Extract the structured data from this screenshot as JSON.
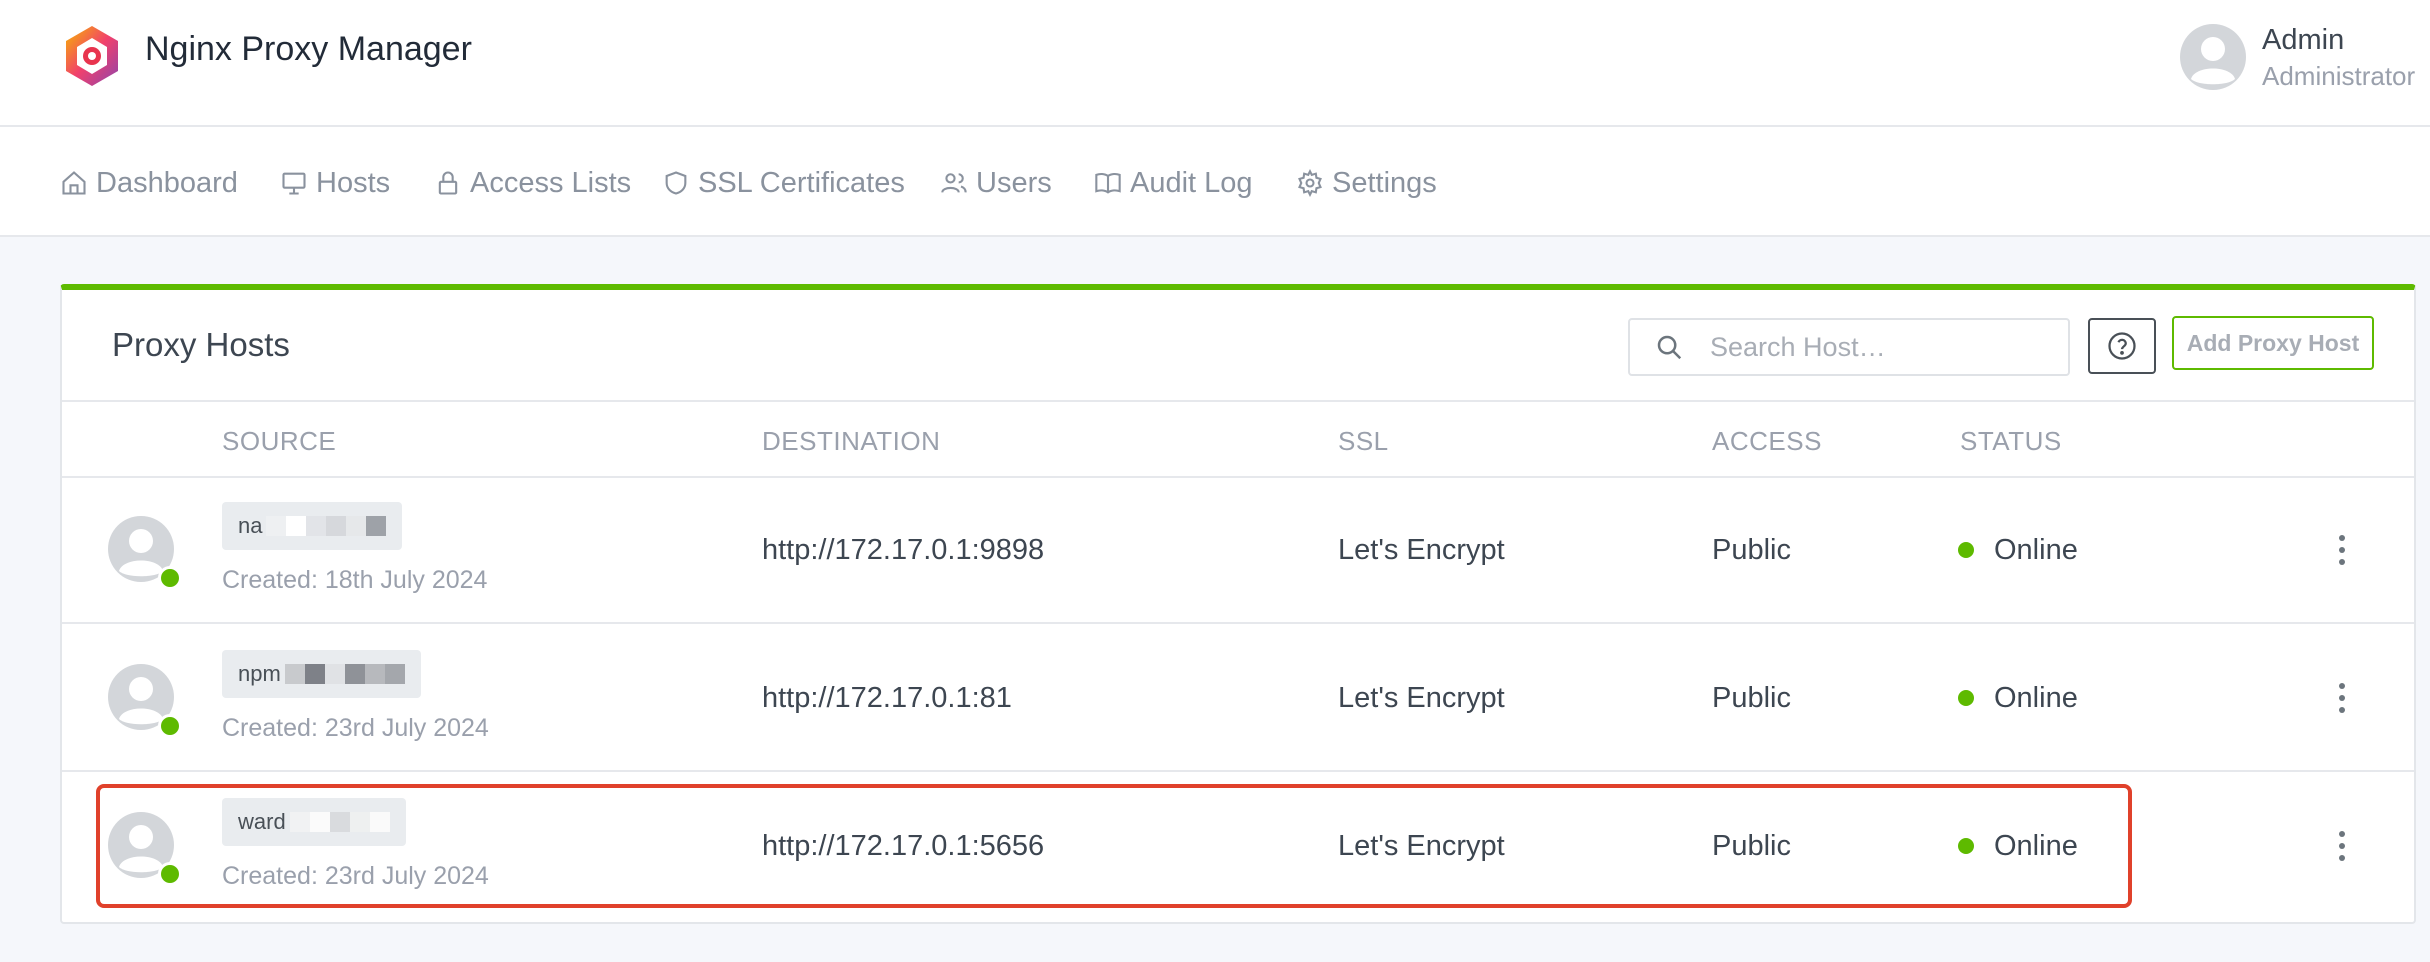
{
  "header": {
    "app_title": "Nginx Proxy Manager",
    "user_name": "Admin",
    "user_role": "Administrator"
  },
  "nav": [
    {
      "label": "Dashboard",
      "icon": "home-icon"
    },
    {
      "label": "Hosts",
      "icon": "monitor-icon"
    },
    {
      "label": "Access Lists",
      "icon": "lock-icon"
    },
    {
      "label": "SSL Certificates",
      "icon": "shield-icon"
    },
    {
      "label": "Users",
      "icon": "users-icon"
    },
    {
      "label": "Audit Log",
      "icon": "book-icon"
    },
    {
      "label": "Settings",
      "icon": "gear-icon"
    }
  ],
  "proxy_hosts": {
    "title": "Proxy Hosts",
    "search_placeholder": "Search Host…",
    "add_button": "Add Proxy Host",
    "columns": [
      "SOURCE",
      "DESTINATION",
      "SSL",
      "ACCESS",
      "STATUS"
    ],
    "rows": [
      {
        "source": "na",
        "created": "Created: 18th July 2024",
        "destination": "http://172.17.0.1:9898",
        "ssl": "Let's Encrypt",
        "access": "Public",
        "status": "Online"
      },
      {
        "source": "npm",
        "created": "Created: 23rd July 2024",
        "destination": "http://172.17.0.1:81",
        "ssl": "Let's Encrypt",
        "access": "Public",
        "status": "Online"
      },
      {
        "source": "ward",
        "created": "Created: 23rd July 2024",
        "destination": "http://172.17.0.1:5656",
        "ssl": "Let's Encrypt",
        "access": "Public",
        "status": "Online"
      }
    ]
  },
  "colors": {
    "accent_green": "#5eba00",
    "highlight_red": "#e0412b"
  }
}
